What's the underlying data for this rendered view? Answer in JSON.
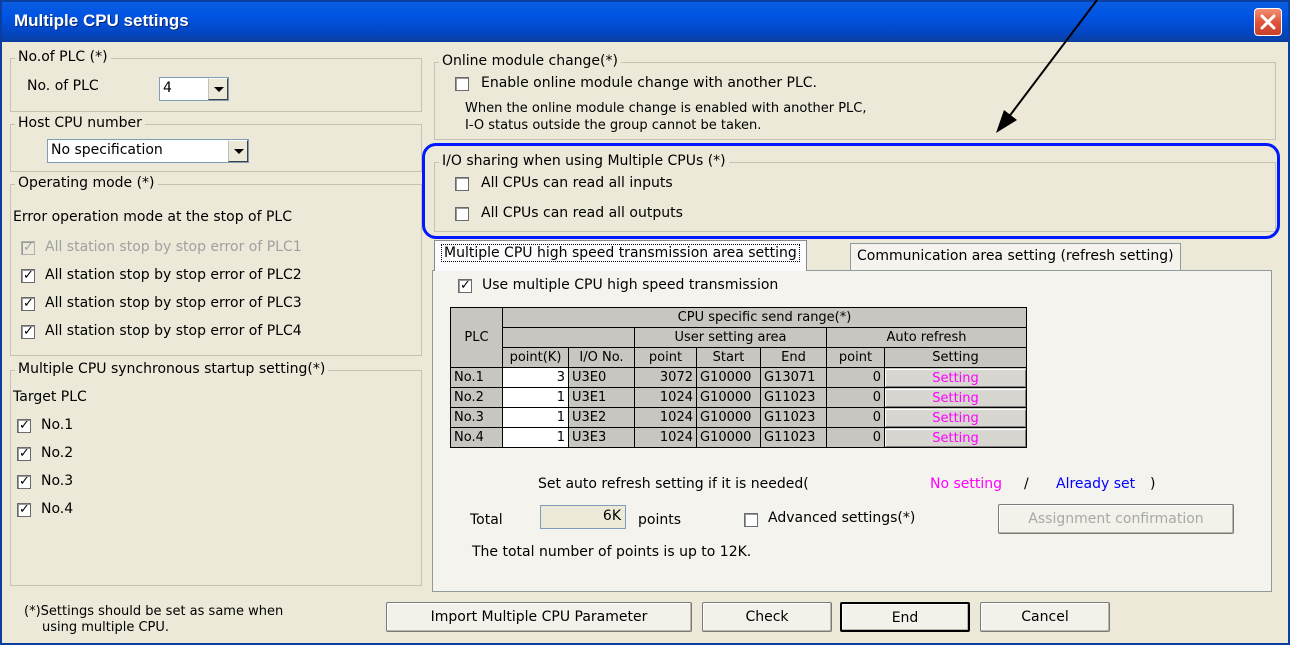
{
  "window": {
    "title": "Multiple CPU settings"
  },
  "no_of_plc": {
    "legend": "No.of PLC (*)",
    "label": "No. of PLC",
    "value": "4"
  },
  "host_cpu": {
    "legend": "Host CPU number",
    "value": "No specification"
  },
  "operating_mode": {
    "legend": "Operating mode (*)",
    "subtitle": "Error operation mode at the stop of PLC",
    "items": [
      {
        "label": "All station stop by stop error of PLC1",
        "checked": true,
        "enabled": false
      },
      {
        "label": "All station stop by stop error of PLC2",
        "checked": true,
        "enabled": true
      },
      {
        "label": "All station stop by stop error of PLC3",
        "checked": true,
        "enabled": true
      },
      {
        "label": "All station stop by stop error of PLC4",
        "checked": true,
        "enabled": true
      }
    ]
  },
  "sync_startup": {
    "legend": "Multiple CPU synchronous startup setting(*)",
    "subtitle": "Target PLC",
    "items": [
      {
        "label": "No.1",
        "checked": true
      },
      {
        "label": "No.2",
        "checked": true
      },
      {
        "label": "No.3",
        "checked": true
      },
      {
        "label": "No.4",
        "checked": true
      }
    ]
  },
  "online_change": {
    "legend": "Online module change(*)",
    "checkbox_label": "Enable online module change with another PLC.",
    "note_line1": "When the online module change is enabled  with another PLC,",
    "note_line2": "I-O status outside the group cannot be taken."
  },
  "io_sharing": {
    "legend": "I/O sharing when using Multiple CPUs (*)",
    "inputs_label": "All CPUs can read all inputs",
    "outputs_label": "All CPUs can read all outputs"
  },
  "tabs": [
    {
      "label": "Multiple CPU high speed transmission area setting",
      "active": true
    },
    {
      "label": "Communication area setting (refresh setting)",
      "active": false
    }
  ],
  "high_speed": {
    "use_label": "Use multiple CPU high speed transmission",
    "table": {
      "h_plc": "PLC",
      "h_range": "CPU specific send range(*)",
      "h_user_area": "User setting area",
      "h_auto_refresh": "Auto refresh",
      "h_point_k": "point(K)",
      "h_io_no": "I/O No.",
      "h_point": "point",
      "h_start": "Start",
      "h_end": "End",
      "h_ar_point": "point",
      "h_setting": "Setting",
      "rows": [
        {
          "plc": "No.1",
          "point_k": "3",
          "io_no": "U3E0",
          "point": "3072",
          "start": "G10000",
          "end": "G13071",
          "ar_point": "0",
          "setting": "Setting"
        },
        {
          "plc": "No.2",
          "point_k": "1",
          "io_no": "U3E1",
          "point": "1024",
          "start": "G10000",
          "end": "G11023",
          "ar_point": "0",
          "setting": "Setting"
        },
        {
          "plc": "No.3",
          "point_k": "1",
          "io_no": "U3E2",
          "point": "1024",
          "start": "G10000",
          "end": "G11023",
          "ar_point": "0",
          "setting": "Setting"
        },
        {
          "plc": "No.4",
          "point_k": "1",
          "io_no": "U3E3",
          "point": "1024",
          "start": "G10000",
          "end": "G11023",
          "ar_point": "0",
          "setting": "Setting"
        }
      ]
    },
    "legend_prefix": "Set auto refresh setting if it is needed(",
    "legend_no_setting": "No setting",
    "legend_slash": "/",
    "legend_already_set": "Already set",
    "legend_suffix": ")",
    "total_label": "Total",
    "total_value": "6K",
    "points_label": "points",
    "advanced_label": "Advanced settings(*)",
    "assign_button": "Assignment confirmation",
    "total_note": "The total number of points is up to 12K."
  },
  "footer": {
    "note_line1": "(*)Settings should be set as same when",
    "note_line2": "using multiple CPU.",
    "import_button": "Import Multiple CPU Parameter",
    "check_button": "Check",
    "end_button": "End",
    "cancel_button": "Cancel"
  },
  "colors": {
    "titlebar": "#0054e3",
    "highlight": "#0019ff",
    "setting_text": "#ff00ff",
    "no_setting": "#ff00ff",
    "already_set": "#0000ff"
  },
  "icons": [
    "close-icon",
    "check-mark-icon",
    "dropdown-arrow-icon",
    "annotation-arrow-icon"
  ]
}
